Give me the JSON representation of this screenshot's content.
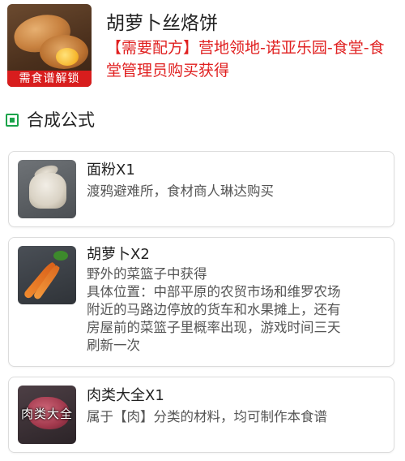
{
  "header": {
    "title": "胡萝卜丝烙饼",
    "description": "【需要配方】营地领地-诺亚乐园-食堂-食堂管理员购买获得",
    "thumb_ribbon": "需食谱解锁",
    "thumb_icon": "bread-icon"
  },
  "section": {
    "title": "合成公式",
    "icon": "green-square-icon",
    "accent_color": "#1aa34a"
  },
  "ingredients": [
    {
      "name": "面粉X1",
      "description": "渡鸦避难所，食材商人琳达购买",
      "icon": "flour-sack-icon"
    },
    {
      "name": "胡萝卜X2",
      "description": "野外的菜篮子中获得\n具体位置：中部平原的农贸市场和维罗农场附近的马路边停放的货车和水果摊上，还有房屋前的菜篮子里概率出现，游戏时间三天刷新一次",
      "description_lines": [
        "野外的菜篮子中获得",
        "具体位置：中部平原的农贸市场和维罗农场",
        "附近的马路边停放的货车和水果摊上，还有",
        "房屋前的菜篮子里概率出现，游戏时间三天",
        "刷新一次"
      ],
      "icon": "carrot-icon"
    },
    {
      "name": "肉类大全X1",
      "description": "属于【肉】分类的材料，均可制作本食谱",
      "icon": "meat-icon",
      "thumb_label": "肉类大全"
    }
  ],
  "colors": {
    "highlight_red": "#e02020",
    "ribbon_red": "#d81d1d",
    "card_border": "#dcdcdc"
  }
}
